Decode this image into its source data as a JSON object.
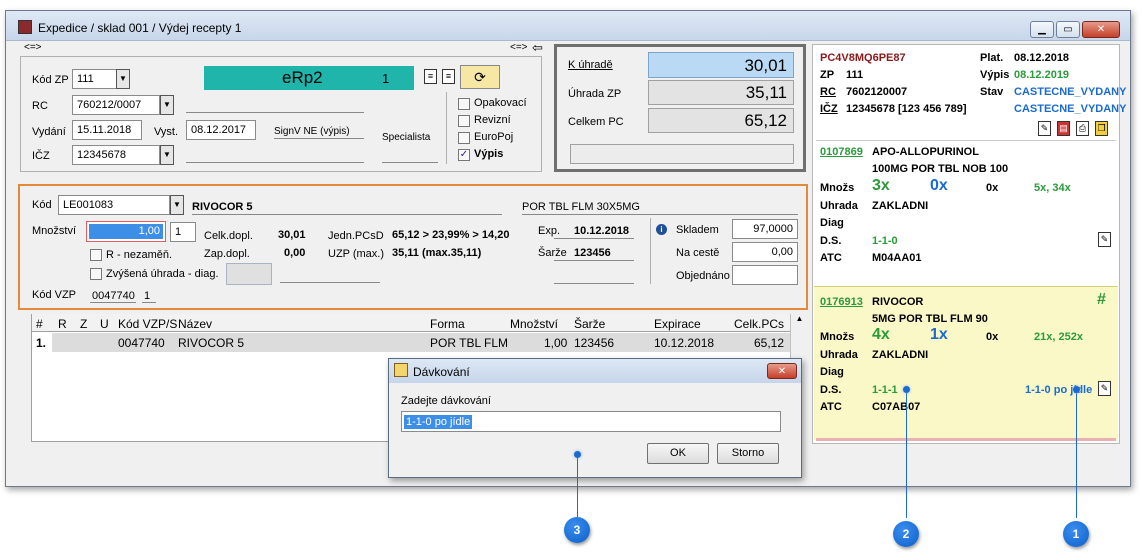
{
  "window": {
    "title": "Expedice / sklad 001 / Výdej recepty 1",
    "min": "▁",
    "max": "▭",
    "close": "✕"
  },
  "nav": {
    "left": "<=>",
    "right": "<=>"
  },
  "header": {
    "kod_zp_label": "Kód ZP",
    "kod_zp": "111",
    "rc_label": "RC",
    "rc": "760212/0007",
    "vydani_label": "Vydání",
    "vydani": "15.11.2018",
    "vyst_label": "Vyst.",
    "vyst": "08.12.2017",
    "icz_label": "IČZ",
    "icz": "12345678",
    "erp_title": "eRp2",
    "erp_count": "1",
    "signv": "SignV NE (výpis)",
    "specialista": "Specialista",
    "checks": [
      {
        "label": "Opakovací",
        "checked": false
      },
      {
        "label": "Revizní",
        "checked": false
      },
      {
        "label": "EuroPoj",
        "checked": false
      },
      {
        "label": "Výpis",
        "checked": true
      }
    ]
  },
  "payment": {
    "k_uhrade_label": "K úhradě",
    "k_uhrade": "30,01",
    "uhrada_zp_label": "Úhrada ZP",
    "uhrada_zp": "35,11",
    "celkem_pc_label": "Celkem PC",
    "celkem_pc": "65,12"
  },
  "item": {
    "kod_label": "Kód",
    "kod": "LE001083",
    "name": "RIVOCOR 5",
    "form": "POR TBL FLM 30X5MG",
    "mnozstvi_label": "Množství",
    "mnozstvi": "1,00",
    "mnozstvi_unit": "1",
    "r_label": "R - nezaměň.",
    "zvysena_label": "Zvýšená úhrada - diag.",
    "kod_vzp_label": "Kód VZP",
    "kod_vzp": "0047740",
    "kod_vzp_n": "1",
    "celk_dopl_label": "Celk.dopl.",
    "celk_dopl": "30,01",
    "zap_dopl_label": "Zap.dopl.",
    "zap_dopl": "0,00",
    "jedn_label": "Jedn.PCsD",
    "jedn": "65,12 > 23,99% > 14,20",
    "uzp_label": "UZP (max.)",
    "uzp": "35,11  (max.35,11)",
    "exp_label": "Exp.",
    "exp": "10.12.2018",
    "sarze_label": "Šarže",
    "sarze": "123456",
    "skladem_label": "Skladem",
    "skladem": "97,0000",
    "na_ceste_label": "Na cestě",
    "na_ceste": "0,00",
    "objednano_label": "Objednáno",
    "objednano": ""
  },
  "table": {
    "headers": [
      "#",
      "R",
      "Z",
      "U",
      "Kód VZP/S",
      "Název",
      "Forma",
      "Množství",
      "Šarže",
      "Expirace",
      "Celk.PCs"
    ],
    "rows": [
      [
        "1.",
        "",
        "",
        "",
        "0047740",
        "RIVOCOR 5",
        "POR TBL FLM",
        "1,00",
        "123456",
        "10.12.2018",
        "65,12"
      ]
    ]
  },
  "dialog": {
    "title": "Dávkování",
    "prompt": "Zadejte dávkování",
    "value": "1-1-0 po jídle",
    "ok": "OK",
    "cancel": "Storno",
    "close": "✕"
  },
  "side": {
    "code": "PC4V8MQ6PE87",
    "plat_label": "Plat.",
    "plat": "08.12.2018",
    "zp_label": "ZP",
    "zp": "111",
    "vypis_label": "Výpis",
    "vypis": "08.12.2019",
    "rc_label": "RC",
    "rc": "7602120007",
    "stav_label": "Stav",
    "stav": "CASTECNE_VYDANY",
    "icz_label": "IČZ",
    "icz": "12345678 [123 456 789]",
    "stav2": "CASTECNE_VYDANY",
    "cards": [
      {
        "code": "0107869",
        "name": "APO-ALLOPURINOL",
        "form": "100MG POR TBL NOB 100",
        "mnozs_label": "Množs",
        "x": "3x",
        "o": "0x",
        "z": "0x",
        "q": "5x, 34x",
        "uhrada_label": "Uhrada",
        "uhrada": "ZAKLADNI",
        "diag_label": "Diag",
        "ds_label": "D.S.",
        "ds": "1-1-0",
        "ds_extra": "",
        "atc_label": "ATC",
        "atc": "M04AA01"
      },
      {
        "code": "0176913",
        "name": "RIVOCOR",
        "form": "5MG POR TBL FLM 90",
        "mnozs_label": "Množs",
        "x": "4x",
        "o": "1x",
        "z": "0x",
        "q": "21x, 252x",
        "uhrada_label": "Uhrada",
        "uhrada": "ZAKLADNI",
        "diag_label": "Diag",
        "ds_label": "D.S.",
        "ds": "1-1-1",
        "ds_extra": "1-1-0 po jídle",
        "atc_label": "ATC",
        "atc": "C07AB07",
        "hash": "#"
      }
    ]
  },
  "markers": [
    "1",
    "2",
    "3"
  ]
}
